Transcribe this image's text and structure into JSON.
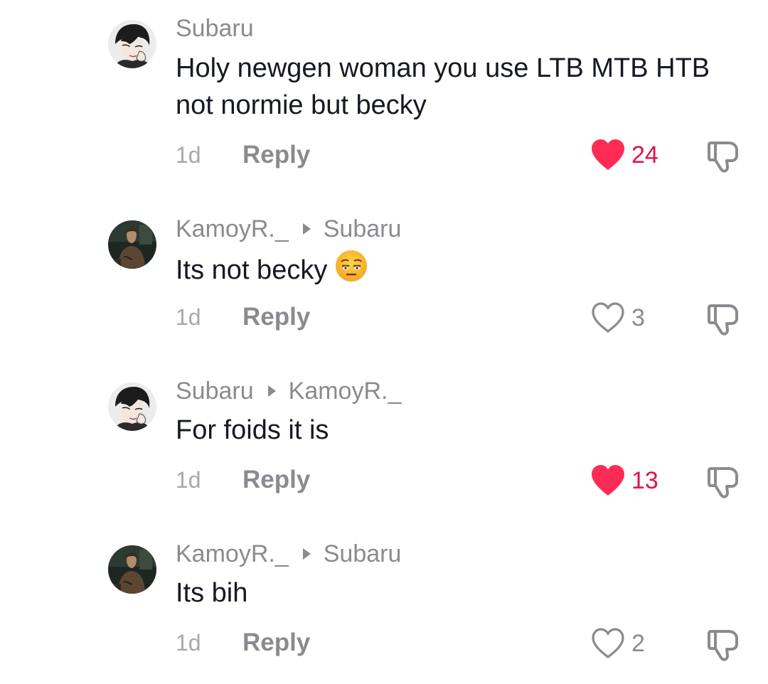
{
  "comments": [
    {
      "author": "Subaru",
      "reply_to": "",
      "text": "Holy newgen woman you use LTB MTB HTB not normie but becky",
      "time": "1d",
      "reply_label": "Reply",
      "likes": "24",
      "liked": true
    },
    {
      "author": "KamoyR._",
      "reply_to": "Subaru",
      "text": "Its not becky",
      "emoji": "relieved-face",
      "time": "1d",
      "reply_label": "Reply",
      "likes": "3",
      "liked": false
    },
    {
      "author": "Subaru",
      "reply_to": "KamoyR._",
      "text": "For foids it is",
      "time": "1d",
      "reply_label": "Reply",
      "likes": "13",
      "liked": true
    },
    {
      "author": "KamoyR._",
      "reply_to": "Subaru",
      "text": "Its bih",
      "time": "1d",
      "reply_label": "Reply",
      "likes": "2",
      "liked": false
    }
  ],
  "colors": {
    "like_active": "#fe2c55",
    "like_count_active": "#e0144c",
    "muted_text": "#8a8b91",
    "primary_text": "#161823"
  },
  "icons": {
    "liked": "heart-filled-icon",
    "not_liked": "heart-outline-icon",
    "dislike": "thumbs-down-icon",
    "reply_arrow": "triangle-right-icon"
  }
}
